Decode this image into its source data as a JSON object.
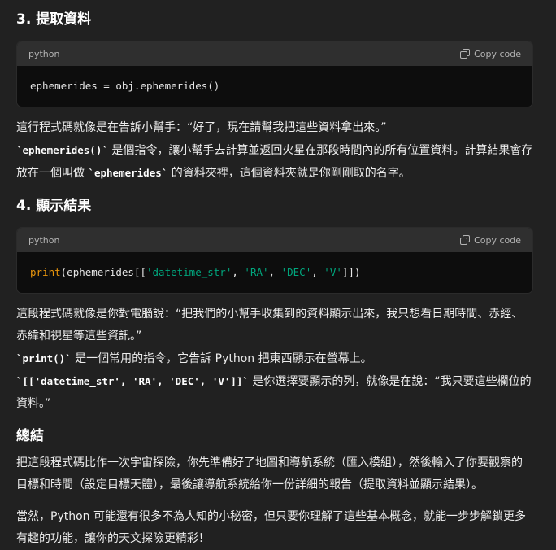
{
  "s3": {
    "title": "3. 提取資料",
    "lang": "python",
    "copy": "Copy code",
    "code": "ephemerides = obj.ephemerides()",
    "p1": "這行程式碼就像是在告訴小幫手：“好了，現在請幫我把這些資料拿出來。”",
    "p2_code": "`ephemerides()`",
    "p2_text": " 是個指令，讓小幫手去計算並返回火星在那段時間內的所有位置資料。計算結果會存放在一個叫做 ",
    "p2_code2": "`ephemerides`",
    "p2_text2": " 的資料夾裡，這個資料夾就是你剛剛取的名字。"
  },
  "s4": {
    "title": "4. 顯示結果",
    "lang": "python",
    "copy": "Copy code",
    "code_fn": "print",
    "code_a": "(ephemerides[[",
    "code_s1": "'datetime_str'",
    "code_c1": ", ",
    "code_s2": "'RA'",
    "code_c2": ", ",
    "code_s3": "'DEC'",
    "code_c3": ", ",
    "code_s4": "'V'",
    "code_b": "]])",
    "p1": "這段程式碼就像是你對電腦說：“把我們的小幫手收集到的資料顯示出來，我只想看日期時間、赤經、赤緯和視星等這些資訊。”",
    "p2_code": "`print()`",
    "p2_text": " 是一個常用的指令，它告訴 Python 把東西顯示在螢幕上。",
    "p3_code": "`[['datetime_str', 'RA', 'DEC', 'V']]`",
    "p3_text": " 是你選擇要顯示的列，就像是在說：“我只要這些欄位的資料。”"
  },
  "summary": {
    "title": "總結",
    "p1": "把這段程式碼比作一次宇宙探險，你先準備好了地圖和導航系統（匯入模組），然後輸入了你要觀察的目標和時間（設定目標天體），最後讓導航系統給你一份詳細的報告（提取資料並顯示結果）。",
    "p2": "當然，Python 可能還有很多不為人知的小秘密，但只要你理解了這些基本概念，就能一步步解鎖更多有趣的功能，讓你的天文探險更精彩！"
  },
  "icons": {
    "copy": "copy-icon"
  }
}
